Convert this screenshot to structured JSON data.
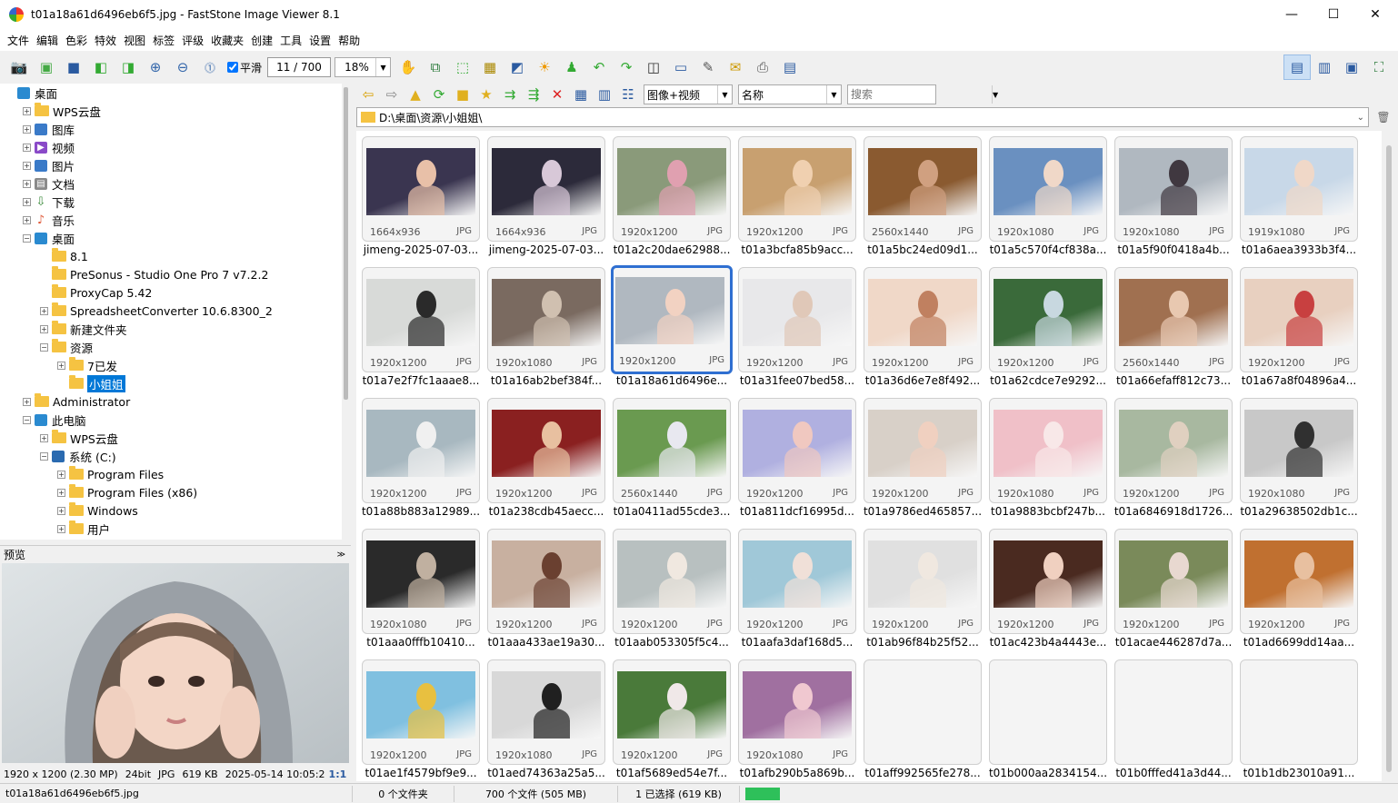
{
  "window": {
    "title": "t01a18a61d6496eb6f5.jpg - FastStone Image Viewer 8.1",
    "minimize": "—",
    "maximize": "☐",
    "close": "✕"
  },
  "menu": [
    "文件",
    "编辑",
    "色彩",
    "特效",
    "视图",
    "标签",
    "评级",
    "收藏夹",
    "创建",
    "工具",
    "设置",
    "帮助"
  ],
  "toolbar": {
    "smooth_label": "平滑",
    "smooth_checked": true,
    "page_counter": "11 / 700",
    "zoom": "18%"
  },
  "tree": {
    "items": [
      {
        "label": "桌面",
        "level": 0,
        "exp": "",
        "icon": "desktop"
      },
      {
        "label": "WPS云盘",
        "level": 1,
        "exp": "+",
        "icon": "folder"
      },
      {
        "label": "图库",
        "level": 1,
        "exp": "+",
        "icon": "pictures"
      },
      {
        "label": "视频",
        "level": 1,
        "exp": "+",
        "icon": "video"
      },
      {
        "label": "图片",
        "level": 1,
        "exp": "+",
        "icon": "pictures"
      },
      {
        "label": "文档",
        "level": 1,
        "exp": "+",
        "icon": "doc"
      },
      {
        "label": "下载",
        "level": 1,
        "exp": "+",
        "icon": "download"
      },
      {
        "label": "音乐",
        "level": 1,
        "exp": "+",
        "icon": "music"
      },
      {
        "label": "桌面",
        "level": 1,
        "exp": "−",
        "icon": "desktop"
      },
      {
        "label": "8.1",
        "level": 2,
        "exp": "",
        "icon": "folder"
      },
      {
        "label": "PreSonus - Studio One Pro 7 v7.2.2",
        "level": 2,
        "exp": "",
        "icon": "folder"
      },
      {
        "label": "ProxyCap 5.42",
        "level": 2,
        "exp": "",
        "icon": "folder"
      },
      {
        "label": "SpreadsheetConverter 10.6.8300_2",
        "level": 2,
        "exp": "+",
        "icon": "folder"
      },
      {
        "label": "新建文件夹",
        "level": 2,
        "exp": "+",
        "icon": "folder"
      },
      {
        "label": "资源",
        "level": 2,
        "exp": "−",
        "icon": "folder"
      },
      {
        "label": "7已发",
        "level": 3,
        "exp": "+",
        "icon": "folder"
      },
      {
        "label": "小姐姐",
        "level": 3,
        "exp": "",
        "icon": "folder",
        "selected": true
      },
      {
        "label": "Administrator",
        "level": 1,
        "exp": "+",
        "icon": "folder"
      },
      {
        "label": "此电脑",
        "level": 1,
        "exp": "−",
        "icon": "pc"
      },
      {
        "label": "WPS云盘",
        "level": 2,
        "exp": "+",
        "icon": "folder"
      },
      {
        "label": "系统 (C:)",
        "level": 2,
        "exp": "−",
        "icon": "drive"
      },
      {
        "label": "Program Files",
        "level": 3,
        "exp": "+",
        "icon": "folder"
      },
      {
        "label": "Program Files (x86)",
        "level": 3,
        "exp": "+",
        "icon": "folder"
      },
      {
        "label": "Windows",
        "level": 3,
        "exp": "+",
        "icon": "folder"
      },
      {
        "label": "用户",
        "level": 3,
        "exp": "+",
        "icon": "folder"
      }
    ]
  },
  "preview": {
    "header": "预览",
    "info": [
      "1920 x 1200 (2.30 MP)",
      "24bit",
      "JPG",
      "619 KB",
      "2025-05-14 10:05:2",
      "1:1"
    ]
  },
  "browser": {
    "filter": "图像+视频",
    "sort": "名称",
    "search_placeholder": "搜索",
    "path": "D:\\桌面\\资源\\小姐姐\\"
  },
  "thumbnails": [
    {
      "name": "jimeng-2025-07-03...",
      "dim": "1664x936",
      "fmt": "JPG",
      "bg": "#3a3550",
      "fg": "#e8c0a8"
    },
    {
      "name": "jimeng-2025-07-03...",
      "dim": "1664x936",
      "fmt": "JPG",
      "bg": "#2c2a3a",
      "fg": "#d8c8d8"
    },
    {
      "name": "t01a2c20dae62988...",
      "dim": "1920x1200",
      "fmt": "JPG",
      "bg": "#8a9a7a",
      "fg": "#e0a0b0"
    },
    {
      "name": "t01a3bcfa85b9acc...",
      "dim": "1920x1200",
      "fmt": "JPG",
      "bg": "#c8a070",
      "fg": "#f0d0b0"
    },
    {
      "name": "t01a5bc24ed09d1...",
      "dim": "2560x1440",
      "fmt": "JPG",
      "bg": "#8a5a30",
      "fg": "#d0a080"
    },
    {
      "name": "t01a5c570f4cf838a...",
      "dim": "1920x1080",
      "fmt": "JPG",
      "bg": "#6a90c0",
      "fg": "#f0d8c8"
    },
    {
      "name": "t01a5f90f0418a4b...",
      "dim": "1920x1080",
      "fmt": "JPG",
      "bg": "#b0b8c0",
      "fg": "#403840"
    },
    {
      "name": "t01a6aea3933b3f4...",
      "dim": "1919x1080",
      "fmt": "JPG",
      "bg": "#c8d8e8",
      "fg": "#f0d8c8"
    },
    {
      "name": "t01a7e2f7fc1aaae8...",
      "dim": "1920x1200",
      "fmt": "JPG",
      "bg": "#d8dad8",
      "fg": "#2a2a2a"
    },
    {
      "name": "t01a16ab2bef384f...",
      "dim": "1920x1080",
      "fmt": "JPG",
      "bg": "#7a6a60",
      "fg": "#d0c0b0"
    },
    {
      "name": "t01a18a61d6496e...",
      "dim": "1920x1200",
      "fmt": "JPG",
      "bg": "#b0b8c0",
      "fg": "#f2d2c2",
      "selected": true
    },
    {
      "name": "t01a31fee07bed58...",
      "dim": "1920x1200",
      "fmt": "JPG",
      "bg": "#e8e8ea",
      "fg": "#e0c8b8"
    },
    {
      "name": "t01a36d6e7e8f492...",
      "dim": "1920x1200",
      "fmt": "JPG",
      "bg": "#f0d8c8",
      "fg": "#c08060"
    },
    {
      "name": "t01a62cdce7e9292...",
      "dim": "1920x1200",
      "fmt": "JPG",
      "bg": "#3a6a3a",
      "fg": "#c8d8e0"
    },
    {
      "name": "t01a66efaff812c73...",
      "dim": "2560x1440",
      "fmt": "JPG",
      "bg": "#a07050",
      "fg": "#e8c8b0"
    },
    {
      "name": "t01a67a8f04896a4...",
      "dim": "1920x1200",
      "fmt": "JPG",
      "bg": "#e8d0c0",
      "fg": "#c84040"
    },
    {
      "name": "t01a88b883a12989...",
      "dim": "1920x1200",
      "fmt": "JPG",
      "bg": "#a8b8c0",
      "fg": "#f0f0f0"
    },
    {
      "name": "t01a238cdb45aecc...",
      "dim": "1920x1200",
      "fmt": "JPG",
      "bg": "#8a2020",
      "fg": "#e8c0a0"
    },
    {
      "name": "t01a0411ad55cde3...",
      "dim": "2560x1440",
      "fmt": "JPG",
      "bg": "#6a9a50",
      "fg": "#e8e8f0"
    },
    {
      "name": "t01a811dcf16995d...",
      "dim": "1920x1200",
      "fmt": "JPG",
      "bg": "#b0b0e0",
      "fg": "#f0c8c0"
    },
    {
      "name": "t01a9786ed465857...",
      "dim": "1920x1200",
      "fmt": "JPG",
      "bg": "#d8d0c8",
      "fg": "#f0d0c0"
    },
    {
      "name": "t01a9883bcbf247b...",
      "dim": "1920x1080",
      "fmt": "JPG",
      "bg": "#f0c0c8",
      "fg": "#f8e8e8"
    },
    {
      "name": "t01a6846918d1726...",
      "dim": "1920x1200",
      "fmt": "JPG",
      "bg": "#a8b8a0",
      "fg": "#e0d0c0"
    },
    {
      "name": "t01a29638502db1c...",
      "dim": "1920x1080",
      "fmt": "JPG",
      "bg": "#c8c8c8",
      "fg": "#303030"
    },
    {
      "name": "t01aaa0fffb10410...",
      "dim": "1920x1080",
      "fmt": "JPG",
      "bg": "#2a2a2a",
      "fg": "#c0b0a0"
    },
    {
      "name": "t01aaa433ae19a30...",
      "dim": "1920x1200",
      "fmt": "JPG",
      "bg": "#c8b0a0",
      "fg": "#6a4030"
    },
    {
      "name": "t01aab053305f5c4...",
      "dim": "1920x1200",
      "fmt": "JPG",
      "bg": "#b8c0c0",
      "fg": "#f0e8e0"
    },
    {
      "name": "t01aafa3daf168d5...",
      "dim": "1920x1200",
      "fmt": "JPG",
      "bg": "#a0c8d8",
      "fg": "#f0e0d8"
    },
    {
      "name": "t01ab96f84b25f52...",
      "dim": "1920x1200",
      "fmt": "JPG",
      "bg": "#e0e0e0",
      "fg": "#f0e8e0"
    },
    {
      "name": "t01ac423b4a4443e...",
      "dim": "1920x1200",
      "fmt": "JPG",
      "bg": "#4a2a20",
      "fg": "#f0d0c0"
    },
    {
      "name": "t01acae446287d7a...",
      "dim": "1920x1200",
      "fmt": "JPG",
      "bg": "#7a8a5a",
      "fg": "#e8d8d0"
    },
    {
      "name": "t01ad6699dd14aa...",
      "dim": "1920x1200",
      "fmt": "JPG",
      "bg": "#c07030",
      "fg": "#e8c0a0"
    },
    {
      "name": "t01ae1f4579bf9e9...",
      "dim": "1920x1200",
      "fmt": "JPG",
      "bg": "#80c0e0",
      "fg": "#e8c040"
    },
    {
      "name": "t01aed74363a25a5...",
      "dim": "1920x1080",
      "fmt": "JPG",
      "bg": "#d8d8d8",
      "fg": "#202020"
    },
    {
      "name": "t01af5689ed54e7f...",
      "dim": "1920x1200",
      "fmt": "JPG",
      "bg": "#4a7a3a",
      "fg": "#f0e8e8"
    },
    {
      "name": "t01afb290b5a869b...",
      "dim": "1920x1080",
      "fmt": "JPG",
      "bg": "#a070a0",
      "fg": "#f0c8d0"
    },
    {
      "name": "t01aff992565fe278...",
      "dim": "",
      "fmt": "",
      "bg": "",
      "fg": ""
    },
    {
      "name": "t01b000aa2834154...",
      "dim": "",
      "fmt": "",
      "bg": "",
      "fg": ""
    },
    {
      "name": "t01b0fffed41a3d44...",
      "dim": "",
      "fmt": "",
      "bg": "",
      "fg": ""
    },
    {
      "name": "t01b1db23010a91...",
      "dim": "",
      "fmt": "",
      "bg": "",
      "fg": ""
    }
  ],
  "status": {
    "filename": "t01a18a61d6496eb6f5.jpg",
    "folders": "0 个文件夹",
    "files": "700 个文件 (505 MB)",
    "selected": "1 已选择 (619 KB)"
  },
  "colors": {
    "selection": "#2f6fd1",
    "tree_selection": "#0078d7",
    "status_ok": "#2ec05a"
  }
}
